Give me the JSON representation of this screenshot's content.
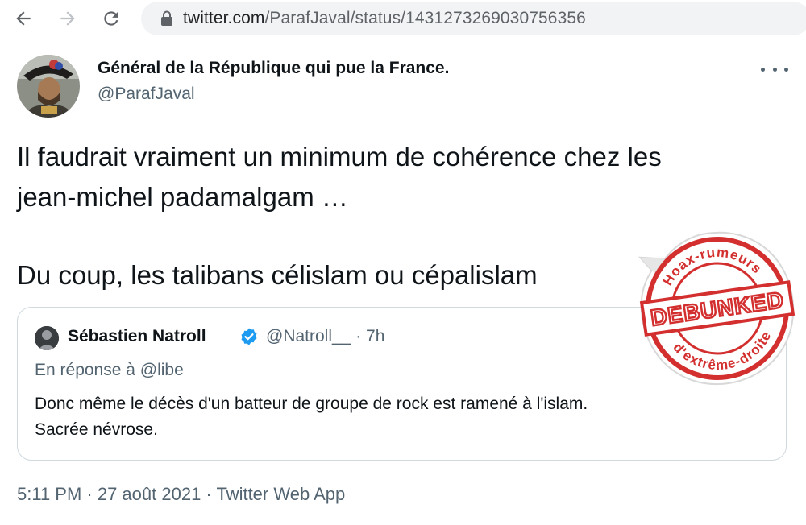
{
  "browser": {
    "url_host": "twitter.com",
    "url_path": "/ParafJaval/status/1431273269030756356"
  },
  "tweet": {
    "display_name": "Général de la République qui pue la France.",
    "handle": "@ParafJaval",
    "text_lines": [
      "Il faudrait vraiment un minimum de cohérence chez les",
      "jean-michel padamalgam …",
      "Du coup, les talibans célislam ou cépalislam"
    ],
    "timestamp": "5:11 PM · 27 août 2021 · Twitter Web App"
  },
  "quote": {
    "name": "Sébastien Natroll",
    "handle_time": "@Natroll__ · 7h",
    "reply_to": "En réponse à @libe",
    "text_lines": [
      "Donc même le décès d'un batteur de groupe de rock est ramené à l'islam.",
      "Sacrée névrose."
    ]
  },
  "stamp": {
    "main": "DEBUNKED",
    "top_arc": "Hoax-rumeurs",
    "bottom_arc": "d'extrême-droite",
    "color": "#d32f2f"
  },
  "colors": {
    "text_primary": "#0f1419",
    "text_secondary": "#536471",
    "verified": "#1d9bf0",
    "border": "#cfd9de"
  }
}
